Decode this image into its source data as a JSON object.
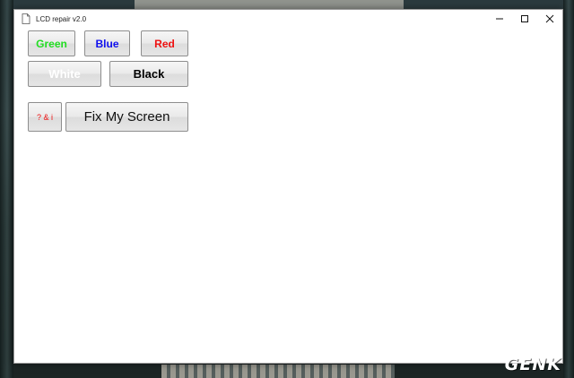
{
  "window": {
    "title": "LCD repair v2.0"
  },
  "buttons": {
    "green": "Green",
    "blue": "Blue",
    "red": "Red",
    "white": "White",
    "black": "Black",
    "help": "? & i",
    "fix": "Fix My Screen"
  },
  "watermark": {
    "text": "GENK"
  },
  "colors": {
    "green": "#22dd22",
    "blue": "#1010ee",
    "red": "#ee1111",
    "white": "#ffffff",
    "black": "#000000"
  },
  "icons": {
    "app": "document-icon",
    "minimize": "minimize-icon",
    "maximize": "maximize-icon",
    "close": "close-icon"
  }
}
